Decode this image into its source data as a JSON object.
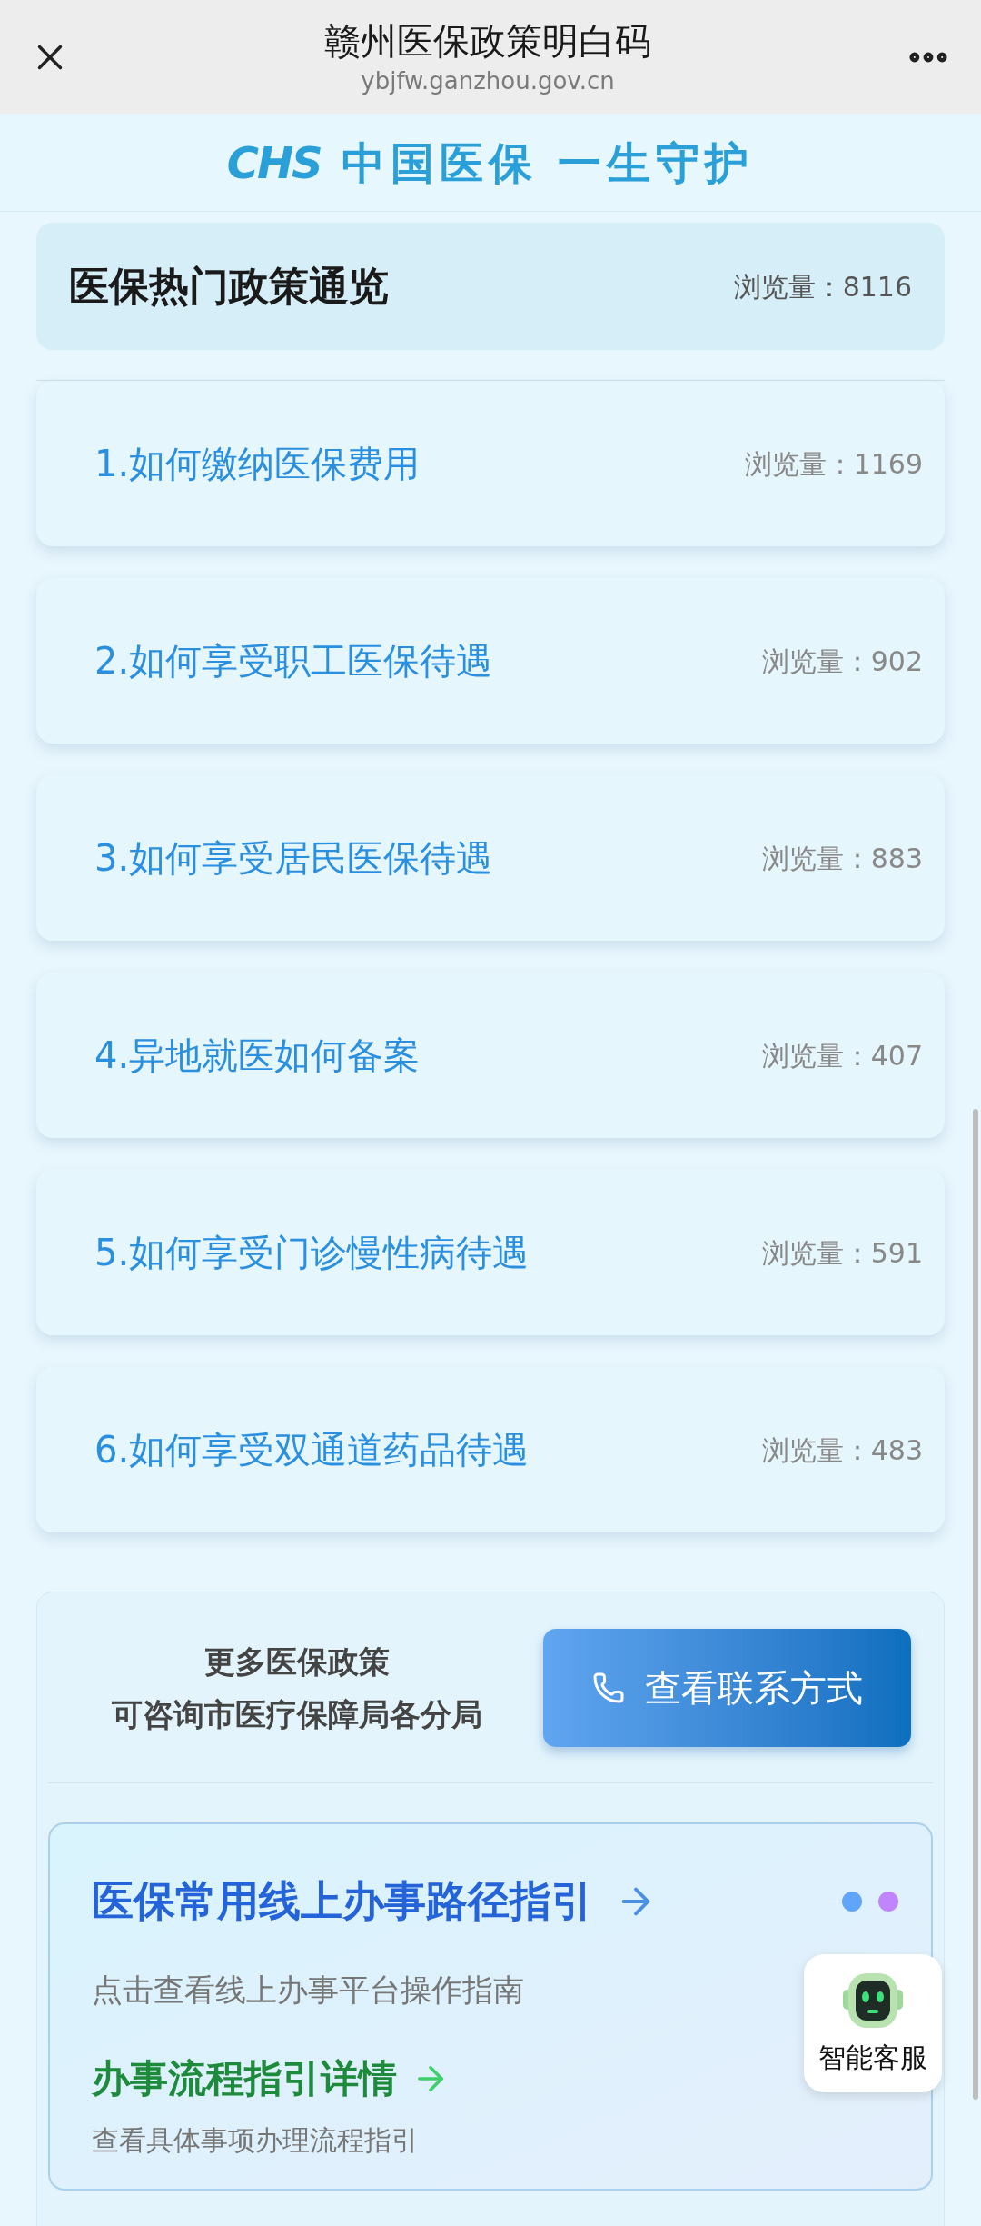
{
  "top_bar": {
    "title": "赣州医保政策明白码",
    "url": "ybjfw.ganzhou.gov.cn"
  },
  "banner": {
    "logo": "CHS",
    "slogan": "中国医保 一生守护"
  },
  "summary": {
    "title": "医保热门政策通览",
    "views": "浏览量：8116"
  },
  "policies": [
    {
      "title": "1.如何缴纳医保费用",
      "views": "浏览量：1169"
    },
    {
      "title": "2.如何享受职工医保待遇",
      "views": "浏览量：902"
    },
    {
      "title": "3.如何享受居民医保待遇",
      "views": "浏览量：883"
    },
    {
      "title": "4.异地就医如何备案",
      "views": "浏览量：407"
    },
    {
      "title": "5.如何享受门诊慢性病待遇",
      "views": "浏览量：591"
    },
    {
      "title": "6.如何享受双通道药品待遇",
      "views": "浏览量：483"
    }
  ],
  "contact": {
    "lines": [
      "更多医保政策",
      "可咨询市医疗保障局各分局"
    ],
    "button": "查看联系方式"
  },
  "guide": {
    "title": "医保常用线上办事路径指引",
    "subtitle": "点击查看线上办事平台操作指南",
    "detail_title": "办事流程指引详情",
    "detail_subtitle": "查看具体事项办理流程指引",
    "dots": [
      {
        "color": "#60a5fa"
      },
      {
        "color": "#c084fc"
      }
    ]
  },
  "assistant": {
    "label": "智能客服"
  }
}
